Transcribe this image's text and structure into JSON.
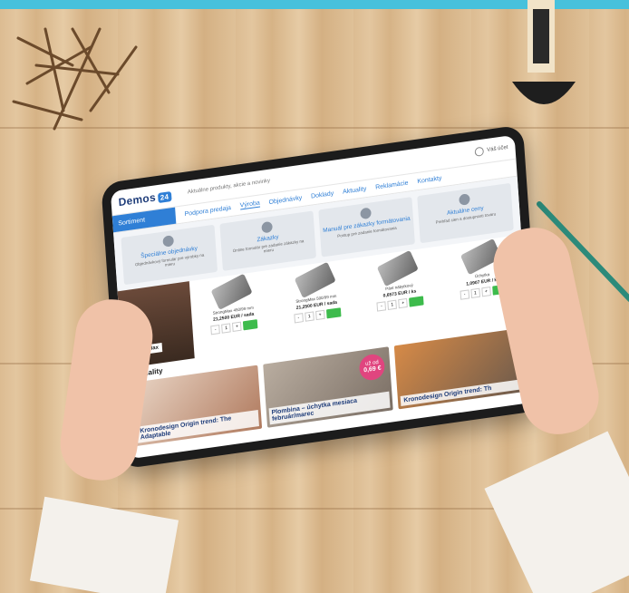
{
  "brand": {
    "name": "Demos",
    "badge": "24",
    "accent": "#2f7fd6",
    "topbar_color": "#47c1dc"
  },
  "header": {
    "note": "Aktuálne produkty, akcie a novinky",
    "user": "Váš účet"
  },
  "nav": {
    "assortment": "Sortiment",
    "items": [
      "Podpora predaja",
      "Výroba",
      "Objednávky",
      "Doklady",
      "Aktuality",
      "Reklamácie",
      "Kontakty"
    ],
    "active_index": 1
  },
  "cards": [
    {
      "title": "Špeciálne objednávky",
      "desc": "Objednávkový formulár pre výrobky na mieru"
    },
    {
      "title": "Zákazky",
      "desc": "Online formulár pre zadanie zákazky na mieru"
    },
    {
      "title": "Manuál pre zákazky formátovania",
      "desc": "Postup pre zadanie formátovania"
    },
    {
      "title": "Aktuálne ceny",
      "desc": "Prehľad cien a dostupnosti tovaru"
    }
  ],
  "promo": {
    "label": "StrongMax"
  },
  "products": [
    {
      "name": "StrongMax 450/99 mm",
      "price": "21,2500 EUR / sada"
    },
    {
      "name": "StrongMax 500/99 mm",
      "price": "21,2500 EUR / sada"
    },
    {
      "name": "Pánt nábytkový",
      "price": "0,6573 EUR / ks"
    },
    {
      "name": "Úchytka",
      "price": "1,0907 EUR / ks"
    }
  ],
  "news": {
    "title": "Aktuality",
    "items": [
      {
        "caption": "Kronodesign Origin trend: The Adaptable"
      },
      {
        "caption": "Plombina – úchytka mesiaca február/marec",
        "badge_top": "už od",
        "badge_price": "0,69 €"
      },
      {
        "caption": "Kronodesign Origin trend: Th"
      }
    ]
  }
}
